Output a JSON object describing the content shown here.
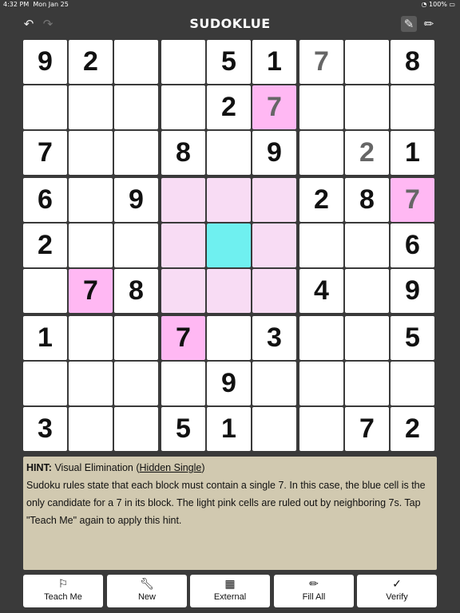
{
  "status_bar": {
    "time": "4:32 PM",
    "date": "Mon Jan 25",
    "battery": "100%"
  },
  "header": {
    "title": "SUDOKLUE"
  },
  "grid": {
    "rows": [
      [
        "9",
        "2",
        "",
        "",
        "5",
        "1",
        "7",
        "",
        "8"
      ],
      [
        "",
        "",
        "",
        "",
        "2",
        "7",
        "",
        "",
        ""
      ],
      [
        "7",
        "",
        "",
        "8",
        "",
        "9",
        "",
        "2",
        "1"
      ],
      [
        "6",
        "",
        "9",
        "",
        "",
        "",
        "2",
        "8",
        "7"
      ],
      [
        "2",
        "",
        "",
        "",
        "",
        "",
        "",
        "",
        "6"
      ],
      [
        "",
        "7",
        "8",
        "",
        "",
        "",
        "4",
        "",
        "9"
      ],
      [
        "1",
        "",
        "",
        "7",
        "",
        "3",
        "",
        "",
        "5"
      ],
      [
        "",
        "",
        "",
        "",
        "9",
        "",
        "",
        "",
        ""
      ],
      [
        "3",
        "",
        "",
        "5",
        "1",
        "",
        "",
        "7",
        "2"
      ]
    ]
  },
  "hint": {
    "label": "HINT:",
    "technique_prefix": "Visual Elimination (",
    "technique_name": "Hidden Single",
    "technique_suffix": ")",
    "body": "Sudoku rules state that each block must contain a single 7. In this case, the blue cell is the only candidate for a 7 in its block.  The light pink cells are ruled out by neighboring 7s. Tap \"Teach Me\" again to apply this hint."
  },
  "bottom_bar": {
    "teach": "Teach Me",
    "new": "New",
    "external": "External",
    "fill_all": "Fill All",
    "verify": "Verify"
  },
  "colors": {
    "background": "#3a3a3a",
    "highlight_pink": "#ffb8f3",
    "highlight_light_pink": "#f8dcf4",
    "highlight_blue": "#6ff0f0",
    "hint_panel": "#d1c9b0"
  }
}
